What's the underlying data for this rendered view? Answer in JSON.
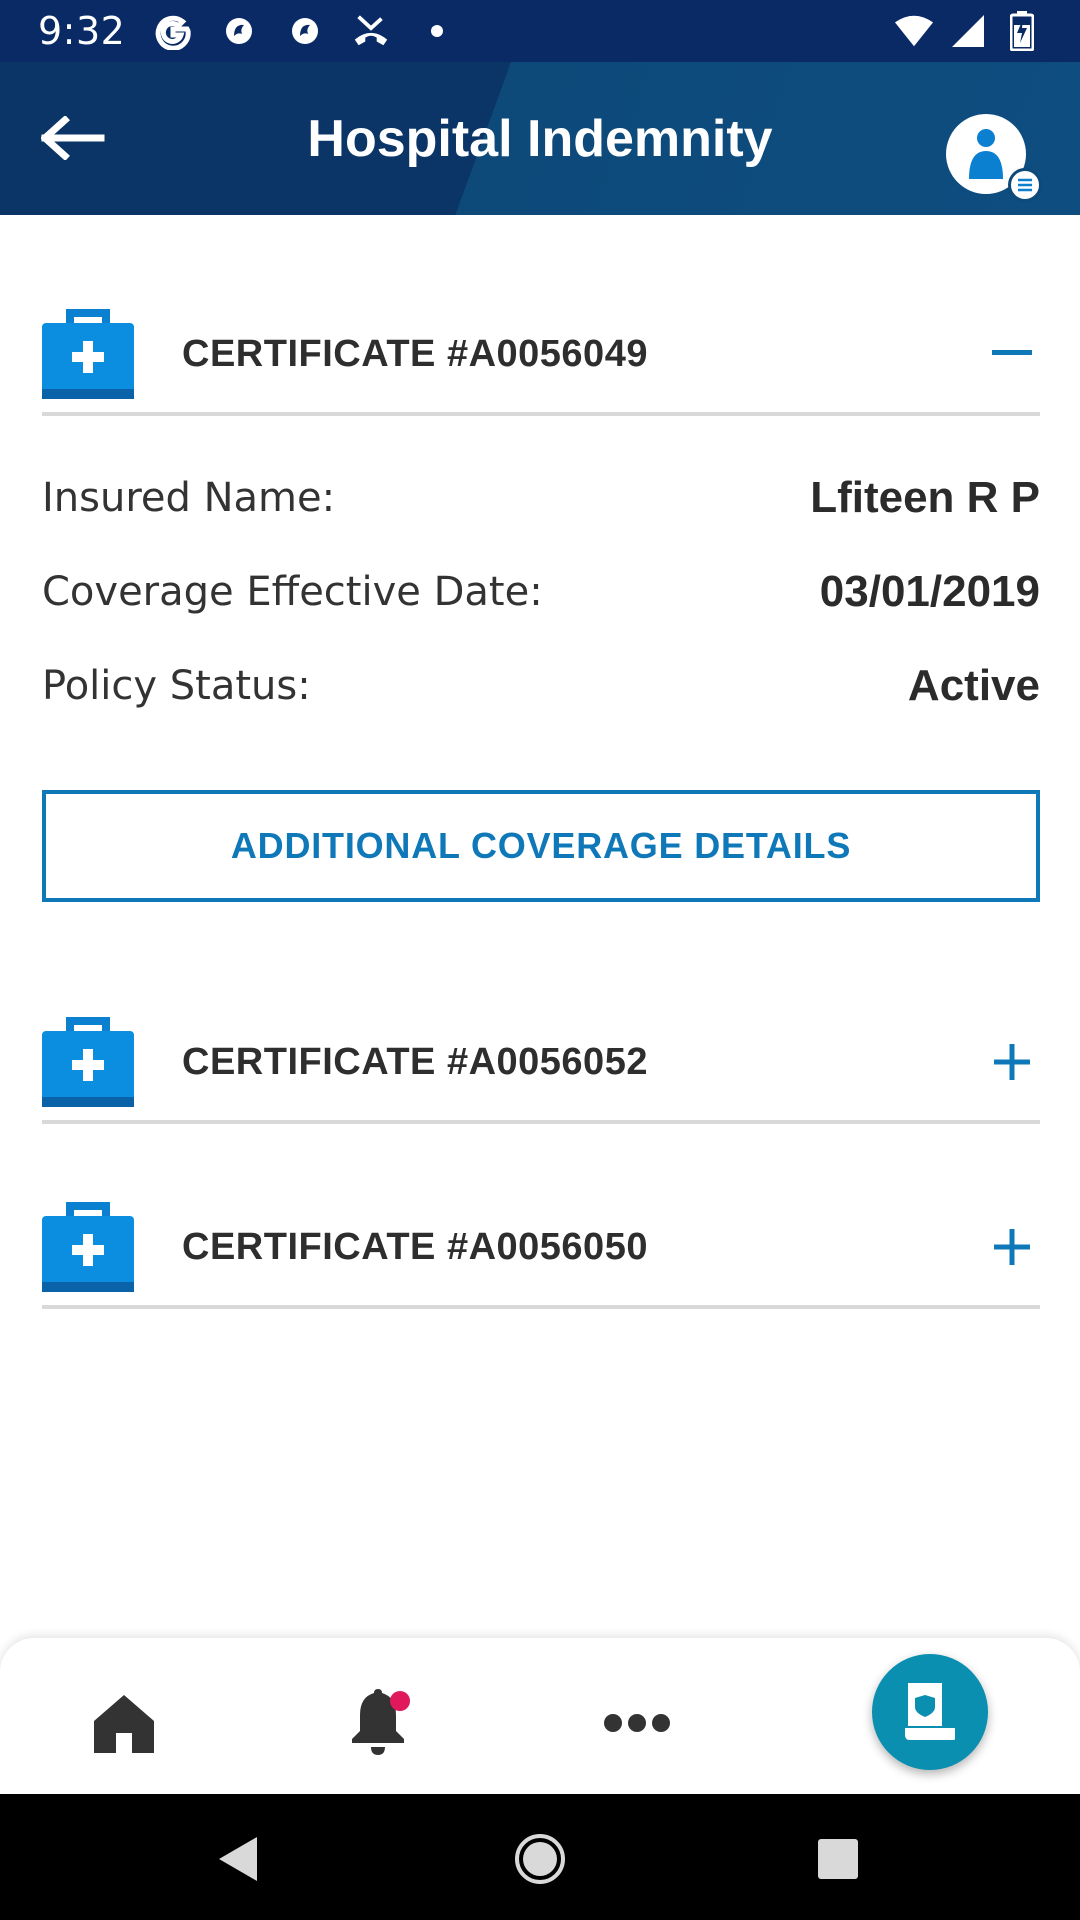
{
  "status_bar": {
    "time": "9:32",
    "left_icons": [
      "google-icon",
      "app-icon",
      "app-icon",
      "missed-call-icon",
      "dot-icon"
    ],
    "right_icons": [
      "wifi-icon",
      "signal-icon",
      "battery-icon"
    ]
  },
  "header": {
    "title": "Hospital Indemnity",
    "back_icon": "arrow-left-icon",
    "profile_icon": "profile-icon"
  },
  "certificates": [
    {
      "label": "CERTIFICATE #A0056049",
      "expanded": true,
      "toggle_symbol": "−",
      "details": [
        {
          "label": "Insured Name:",
          "value": "Lfiteen R P"
        },
        {
          "label": "Coverage Effective Date:",
          "value": "03/01/2019"
        },
        {
          "label": "Policy Status:",
          "value": "Active"
        }
      ],
      "action_label": "ADDITIONAL COVERAGE DETAILS"
    },
    {
      "label": "CERTIFICATE #A0056052",
      "expanded": false,
      "toggle_symbol": "+"
    },
    {
      "label": "CERTIFICATE #A0056050",
      "expanded": false,
      "toggle_symbol": "+"
    }
  ],
  "bottom_nav": {
    "items": [
      "home-icon",
      "bell-icon",
      "more-icon"
    ],
    "fab_icon": "policy-icon",
    "notification_dot_color": "#e0185c"
  },
  "colors": {
    "status_bar": "#0a2a66",
    "header": "#0a3566",
    "accent": "#0f78b8",
    "icon_blue": "#0b7fd0",
    "fab": "#0a8fb0"
  }
}
